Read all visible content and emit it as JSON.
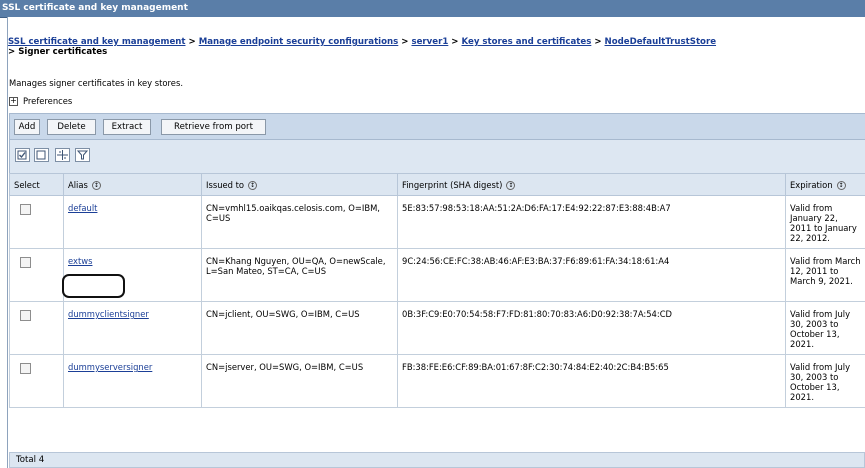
{
  "window": {
    "title": "SSL certificate and key management"
  },
  "breadcrumb": {
    "links": [
      "SSL certificate and key management",
      "Manage endpoint security configurations",
      "server1",
      "Key stores and certificates",
      "NodeDefaultTrustStore"
    ],
    "separator": " > ",
    "current": "> Signer certificates"
  },
  "description": "Manages signer certificates in key stores.",
  "preferences": {
    "label": "Preferences",
    "toggle": "+"
  },
  "toolbar": {
    "add": "Add",
    "delete": "Delete",
    "extract": "Extract",
    "retrieve": "Retrieve from port"
  },
  "iconbar": {
    "icons": [
      "select-all-icon",
      "deselect-all-icon",
      "show-filter-icon",
      "clear-filter-icon"
    ]
  },
  "table": {
    "headers": {
      "select": "Select",
      "alias": "Alias",
      "issued_to": "Issued to",
      "fingerprint": "Fingerprint (SHA digest)",
      "expiration": "Expiration"
    },
    "rows": [
      {
        "alias": "default",
        "issued_to": "CN=vmhl15.oaikqas.celosis.com, O=IBM, C=US",
        "fingerprint": "5E:83:57:98:53:18:AA:51:2A:D6:FA:17:E4:92:22:87:E3:88:4B:A7",
        "expiration": "Valid from January 22, 2011 to January 22, 2012."
      },
      {
        "alias": "extws",
        "issued_to": "CN=Khang Nguyen, OU=QA, O=newScale, L=San Mateo, ST=CA, C=US",
        "fingerprint": "9C:24:56:CE:FC:38:AB:46:AF:E3:BA:37:F6:89:61:FA:34:18:61:A4",
        "expiration": "Valid from March 12, 2011 to March 9, 2021."
      },
      {
        "alias": "dummyclientsigner",
        "issued_to": "CN=jclient, OU=SWG, O=IBM, C=US",
        "fingerprint": "0B:3F:C9:E0:70:54:58:F7:FD:81:80:70:83:A6:D0:92:38:7A:54:CD",
        "expiration": "Valid from July 30, 2003 to October 13, 2021."
      },
      {
        "alias": "dummyserversigner",
        "issued_to": "CN=jserver, OU=SWG, O=IBM, C=US",
        "fingerprint": "FB:38:FE:E6:CF:89:BA:01:67:8F:C2:30:74:84:E2:40:2C:B4:B5:65",
        "expiration": "Valid from July 30, 2003 to October 13, 2021."
      }
    ],
    "total": "Total 4"
  },
  "colors": {
    "titlebar": "#5a7ea8",
    "link": "#1b3f97",
    "toolbar_bg": "#c9d8ea",
    "header_bg": "#dce6f1"
  }
}
